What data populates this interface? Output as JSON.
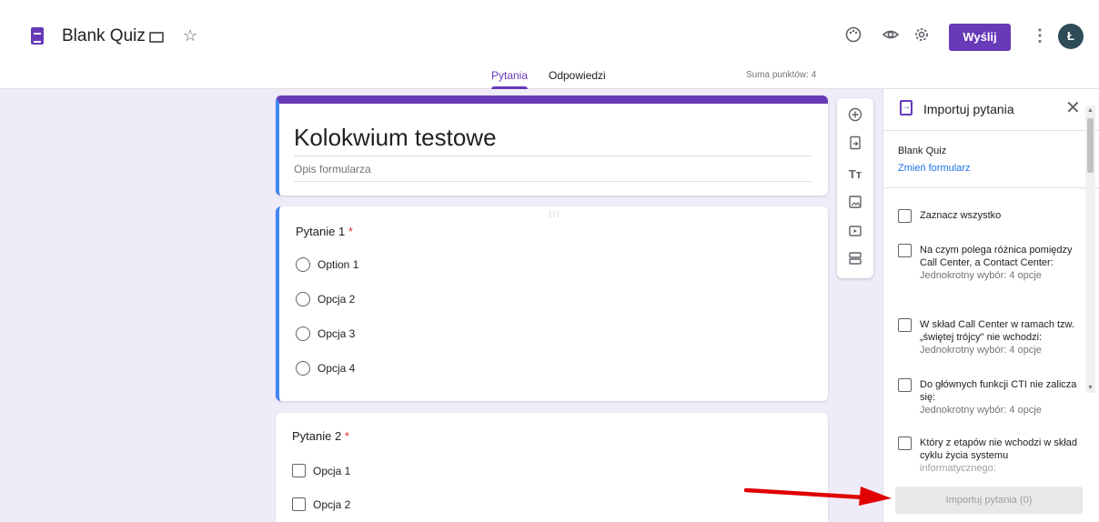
{
  "header": {
    "title": "Blank Quiz",
    "send_label": "Wyślij",
    "avatar_initial": "Ł",
    "tabs": [
      {
        "label": "Pytania",
        "active": true
      },
      {
        "label": "Odpowiedzi",
        "active": false
      }
    ],
    "points": "Suma punktów: 4",
    "icons": [
      "folder-icon",
      "star-icon",
      "palette-icon",
      "eye-icon",
      "gear-icon",
      "more-icon"
    ],
    "accent": "#673ab7"
  },
  "form": {
    "title": "Kolokwium testowe",
    "description": "Opis formularza"
  },
  "questions": [
    {
      "title": "Pytanie 1",
      "required_mark": "*",
      "type": "radio",
      "options": [
        "Option 1",
        "Opcja 2",
        "Opcja 3",
        "Opcja 4"
      ]
    },
    {
      "title": "Pytanie 2",
      "required_mark": "*",
      "type": "checkbox",
      "options": [
        "Opcja 1",
        "Opcja 2"
      ]
    }
  ],
  "toolbar": {
    "tools": [
      "add-question-icon",
      "import-icon",
      "title-text-icon",
      "image-icon",
      "video-icon",
      "section-icon"
    ]
  },
  "panel": {
    "title": "Importuj pytania",
    "source_form": "Blank Quiz",
    "change_link": "Zmień formularz",
    "select_all": "Zaznacz wszystko",
    "items": [
      {
        "text": "Na czym polega różnica pomiędzy Call Center, a Contact Center:",
        "sub": "Jednokrotny wybór: 4 opcje"
      },
      {
        "text": "W skład Call Center w ramach tzw. „świętej trójcy\" nie wchodzi:",
        "sub": "Jednokrotny wybór: 4 opcje"
      },
      {
        "text": "Do głównych funkcji CTI nie zalicza się:",
        "sub": "Jednokrotny wybór: 4 opcje"
      },
      {
        "text": "Który z etapów nie wchodzi w skład cyklu życia systemu",
        "faded_text": "informatycznego:"
      }
    ],
    "import_button": "Importuj pytania (0)"
  }
}
